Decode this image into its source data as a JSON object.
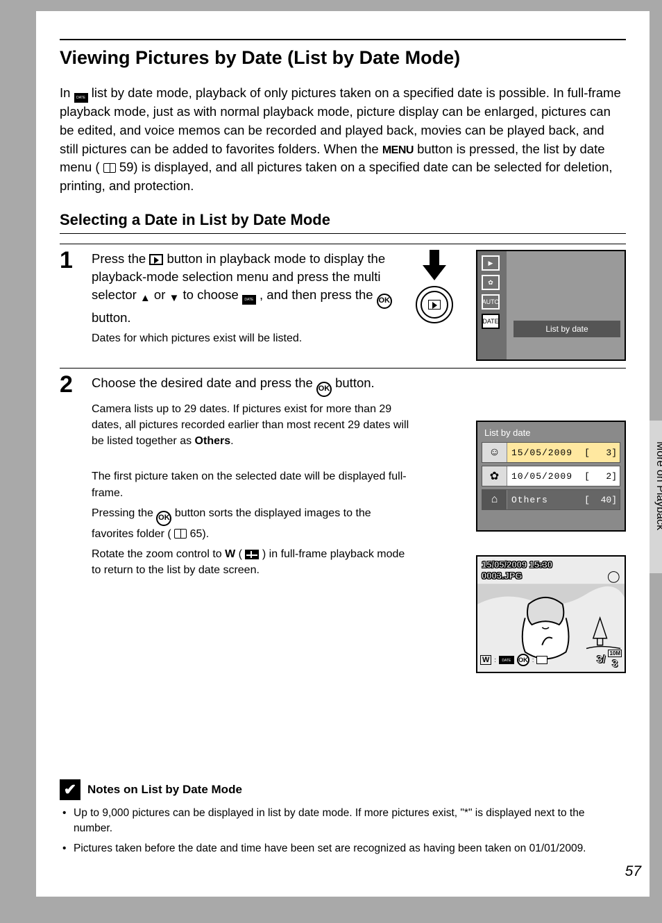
{
  "sideTab": "More on Playback",
  "title": "Viewing Pictures by Date (List by Date Mode)",
  "intro": {
    "t1": "In ",
    "t2": " list by date mode, playback of only pictures taken on a specified date is possible. In full-frame playback mode, just as with normal playback mode, picture display can be enlarged, pictures can be edited, and voice memos can be recorded and played back, movies can be played back, and still pictures can be added to favorites folders. When the ",
    "menuWord": "MENU",
    "t3": " button is pressed, the list by date menu (",
    "pageRef1": " 59) is displayed, and all pictures taken on a specified date can be selected for deletion, printing, and protection."
  },
  "subheading": "Selecting a Date in List by Date Mode",
  "step1": {
    "num": "1",
    "a": "Press the ",
    "b": " button in playback mode to display the playback-mode selection menu and press the multi selector ",
    "or": " or ",
    "c": " to choose ",
    "d": ", and then press the ",
    "e": " button.",
    "sub": "Dates for which pictures exist will be listed.",
    "ok": "OK"
  },
  "cam1": {
    "label": "List by date"
  },
  "step2": {
    "num": "2",
    "a": "Choose the desired date and press the ",
    "b": " button.",
    "sub1a": "Camera lists up to 29 dates. If pictures exist for more than 29 dates, all pictures recorded earlier than most recent 29 dates will be listed together as ",
    "others": "Others",
    "sub1b": ".",
    "sub2": "The first picture taken on the selected date will be displayed full-frame.",
    "sub3a": "Pressing the ",
    "sub3b": " button sorts the displayed images to the favorites folder (",
    "sub3c": " 65).",
    "sub4a": "Rotate the zoom control to ",
    "W": "W",
    "sub4b": " (",
    "sub4c": ") in full-frame playback mode to return to the list by date screen.",
    "ok": "OK"
  },
  "cam2": {
    "title": "List by date",
    "rows": [
      {
        "date": "15/05/2009",
        "count": "3"
      },
      {
        "date": "10/05/2009",
        "count": "2"
      },
      {
        "date": "Others",
        "count": "40"
      }
    ]
  },
  "cam3": {
    "line1": "15/05/2009 15:30",
    "line2": "0003.JPG",
    "w": "W",
    "ok": "OK",
    "idx": "3/",
    "total": "3",
    "res": "10M"
  },
  "notes": {
    "heading": "Notes on List by Date Mode",
    "items": [
      "Up to 9,000 pictures can be displayed in list by date mode. If more pictures exist, \"*\" is displayed next to the number.",
      "Pictures taken before the date and time have been set are recognized as having been taken on 01/01/2009."
    ]
  },
  "pageNumber": "57"
}
